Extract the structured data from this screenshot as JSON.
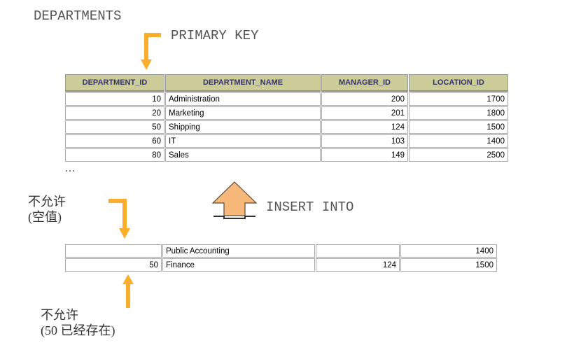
{
  "labels": {
    "title": "DEPARTMENTS",
    "primary_key": "PRIMARY KEY",
    "insert_into": "INSERT INTO",
    "not_allowed_null_l1": "不允许",
    "not_allowed_null_l2": "(空值)",
    "not_allowed_dup_l1": "不允许",
    "not_allowed_dup_l2": "(50 已经存在)",
    "ellipsis": "…"
  },
  "table": {
    "headers": [
      "DEPARTMENT_ID",
      "DEPARTMENT_NAME",
      "MANAGER_ID",
      "LOCATION_ID"
    ],
    "rows": [
      {
        "id": "10",
        "name": "Administration",
        "mgr": "200",
        "loc": "1700"
      },
      {
        "id": "20",
        "name": "Marketing",
        "mgr": "201",
        "loc": "1800"
      },
      {
        "id": "50",
        "name": "Shipping",
        "mgr": "124",
        "loc": "1500"
      },
      {
        "id": "60",
        "name": "IT",
        "mgr": "103",
        "loc": "1400"
      },
      {
        "id": "80",
        "name": "Sales",
        "mgr": "149",
        "loc": "2500"
      }
    ]
  },
  "insert_rows": [
    {
      "id": "",
      "name": "Public Accounting",
      "mgr": "",
      "loc": "1400"
    },
    {
      "id": "50",
      "name": "Finance",
      "mgr": "124",
      "loc": "1500"
    }
  ],
  "colors": {
    "arrow": "#faae29",
    "insert_fill": "#f8b87a",
    "insert_stroke": "#5a4a3a",
    "header_bg": "#cccc99",
    "header_fg": "#333366"
  }
}
